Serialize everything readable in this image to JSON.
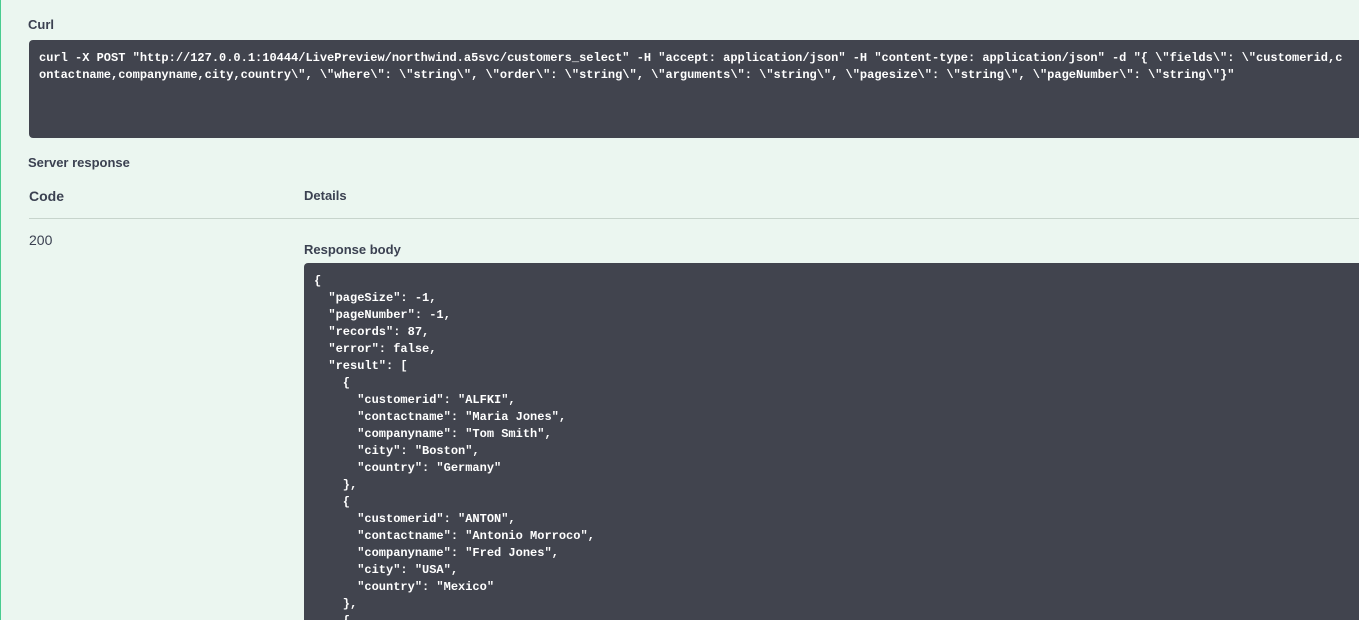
{
  "curl": {
    "label": "Curl",
    "command": "curl -X POST \"http://127.0.0.1:10444/LivePreview/northwind.a5svc/customers_select\" -H \"accept: application/json\" -H \"content-type: application/json\" -d \"{ \\\"fields\\\": \\\"customerid,contactname,companyname,city,country\\\", \\\"where\\\": \\\"string\\\", \\\"order\\\": \\\"string\\\", \\\"arguments\\\": \\\"string\\\", \\\"pagesize\\\": \\\"string\\\", \\\"pageNumber\\\": \\\"string\\\"}\""
  },
  "server_response": {
    "label": "Server response",
    "code_header": "Code",
    "details_header": "Details",
    "code": "200",
    "response_body_label": "Response body",
    "response_body": "{\n  \"pageSize\": -1,\n  \"pageNumber\": -1,\n  \"records\": 87,\n  \"error\": false,\n  \"result\": [\n    {\n      \"customerid\": \"ALFKI\",\n      \"contactname\": \"Maria Jones\",\n      \"companyname\": \"Tom Smith\",\n      \"city\": \"Boston\",\n      \"country\": \"Germany\"\n    },\n    {\n      \"customerid\": \"ANTON\",\n      \"contactname\": \"Antonio Morroco\",\n      \"companyname\": \"Fred Jones\",\n      \"city\": \"USA\",\n      \"country\": \"Mexico\"\n    },\n    {"
  },
  "colors": {
    "panel_background": "#ebf6f0",
    "panel_border": "#49cc90",
    "code_block_background": "#41444e",
    "text": "#3b4151"
  }
}
